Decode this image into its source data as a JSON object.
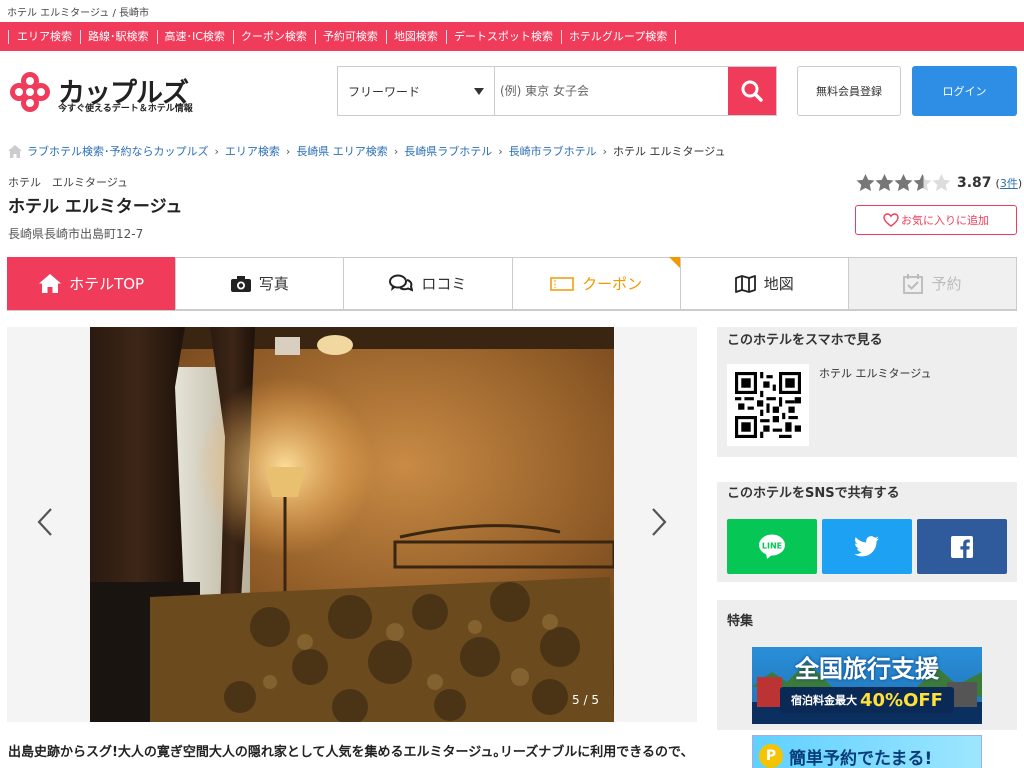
{
  "top_strip": {
    "text": "ホテル エルミタージュ / 長崎市"
  },
  "nav": {
    "items": [
      "エリア検索",
      "路線･駅検索",
      "高速･IC検索",
      "クーポン検索",
      "予約可検索",
      "地図検索",
      "デートスポット検索",
      "ホテルグループ検索"
    ]
  },
  "header": {
    "logo_text": "カップルズ",
    "logo_sub": "今すぐ使えるデート＆ホテル情報",
    "search_select": "フリーワード",
    "search_placeholder": "(例) 東京 女子会",
    "register_label": "無料会員登録",
    "login_label": "ログイン"
  },
  "breadcrumb": {
    "items": [
      "ラブホテル検索･予約ならカップルズ",
      "エリア検索",
      "長崎県 エリア検索",
      "長崎県ラブホテル",
      "長崎市ラブホテル"
    ],
    "current": "ホテル エルミタージュ"
  },
  "hotel": {
    "kana": "ホテル　エルミタージュ",
    "name": "ホテル エルミタージュ",
    "address": "長崎県長崎市出島町12-7",
    "rating": 3.87,
    "rating_text": "3.87",
    "review_count_prefix": "(",
    "review_count": "3件",
    "review_count_suffix": ")",
    "favorite_label": "お気に入りに追加"
  },
  "tabs": [
    {
      "label": "ホテルTOP",
      "icon": "home-icon"
    },
    {
      "label": "写真",
      "icon": "camera-icon"
    },
    {
      "label": "ロコミ",
      "icon": "chat-icon"
    },
    {
      "label": "クーポン",
      "icon": "ticket-icon"
    },
    {
      "label": "地図",
      "icon": "map-icon"
    },
    {
      "label": "予約",
      "icon": "calendar-check-icon"
    }
  ],
  "gallery": {
    "counter": "5 / 5"
  },
  "description": "出島史跡からスグ!大人の寛ぎ空間大人の隠れ家として人気を集めるエルミタージュ｡リーズナブルに利用できるので､",
  "sidebar": {
    "smartphone_title": "このホテルをスマホで見る",
    "qr_hotel_name": "ホテル エルミタージュ",
    "sns_title": "このホテルをSNSで共有する",
    "sns_line_label": "LINE",
    "feature_title": "特集",
    "banner1_title": "全国旅行支援",
    "banner1_sub": "宿泊料金最大",
    "banner1_pct": "40%OFF",
    "banner2_text": "簡単予約でたまる!"
  },
  "colors": {
    "brand": "#f03c5a",
    "login": "#2e8ee6",
    "coupon": "#f39800",
    "line": "#06c755",
    "twitter": "#1da1f2",
    "facebook": "#2f5a9c"
  }
}
